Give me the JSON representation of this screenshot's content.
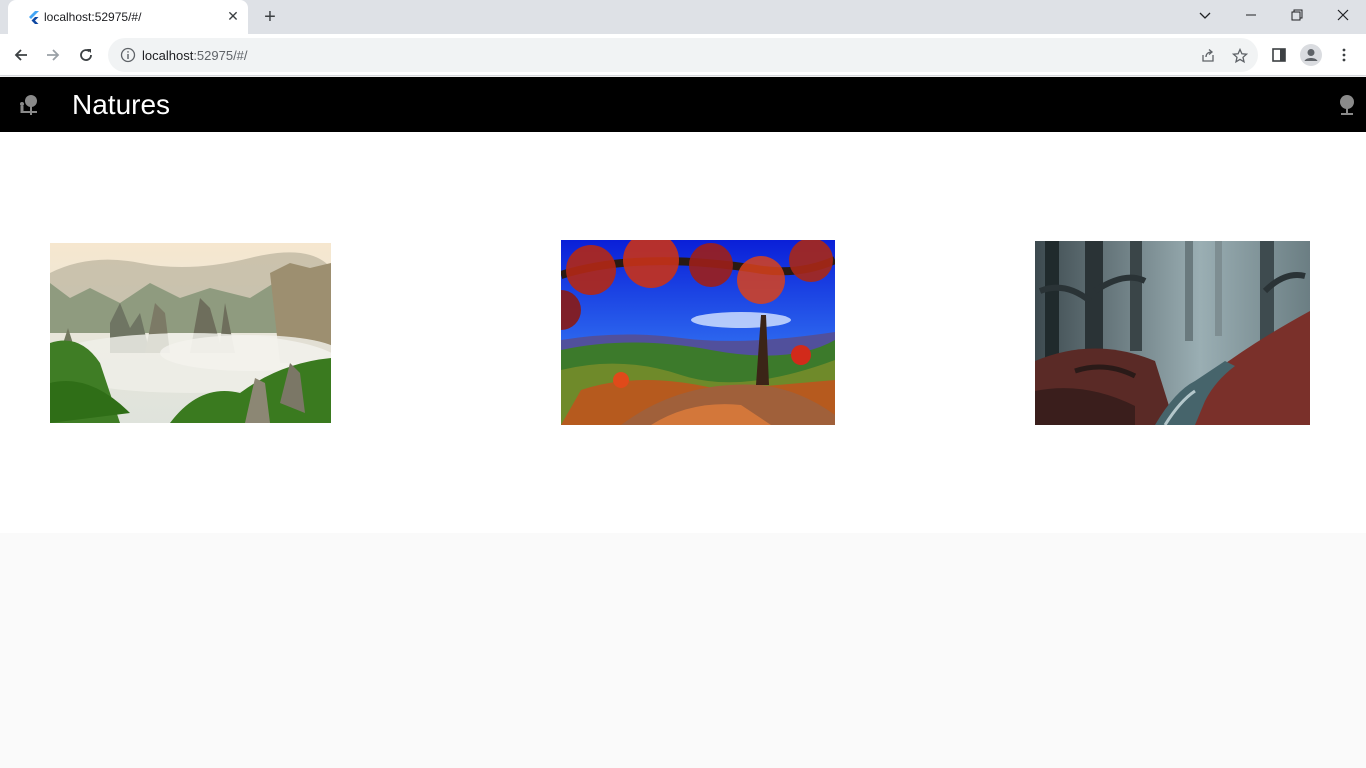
{
  "browser": {
    "tab_title": "localhost:52975/#/",
    "tab_close": "✕",
    "new_tab": "+",
    "url_host": "localhost",
    "url_rest": ":52975/#/",
    "icons": [
      "flutter-favicon-icon",
      "chevron-down-icon",
      "minimize-icon",
      "restore-icon",
      "close-icon",
      "back-icon",
      "forward-icon",
      "reload-icon",
      "info-icon",
      "share-icon",
      "star-icon",
      "side-panel-icon",
      "profile-icon",
      "menu-icon"
    ]
  },
  "app": {
    "title": "Natures",
    "leading_icon": "nature-people-icon",
    "action_icon": "nature-icon",
    "colors": {
      "appbar": "#000000",
      "title": "#ffffff",
      "icons": "#8a8a8a",
      "background": "#fafafa",
      "panel": "#ffffff"
    },
    "images": [
      {
        "name": "misty-mountain-peaks"
      },
      {
        "name": "autumn-tree-overlook"
      },
      {
        "name": "foggy-forest-stream"
      }
    ]
  }
}
